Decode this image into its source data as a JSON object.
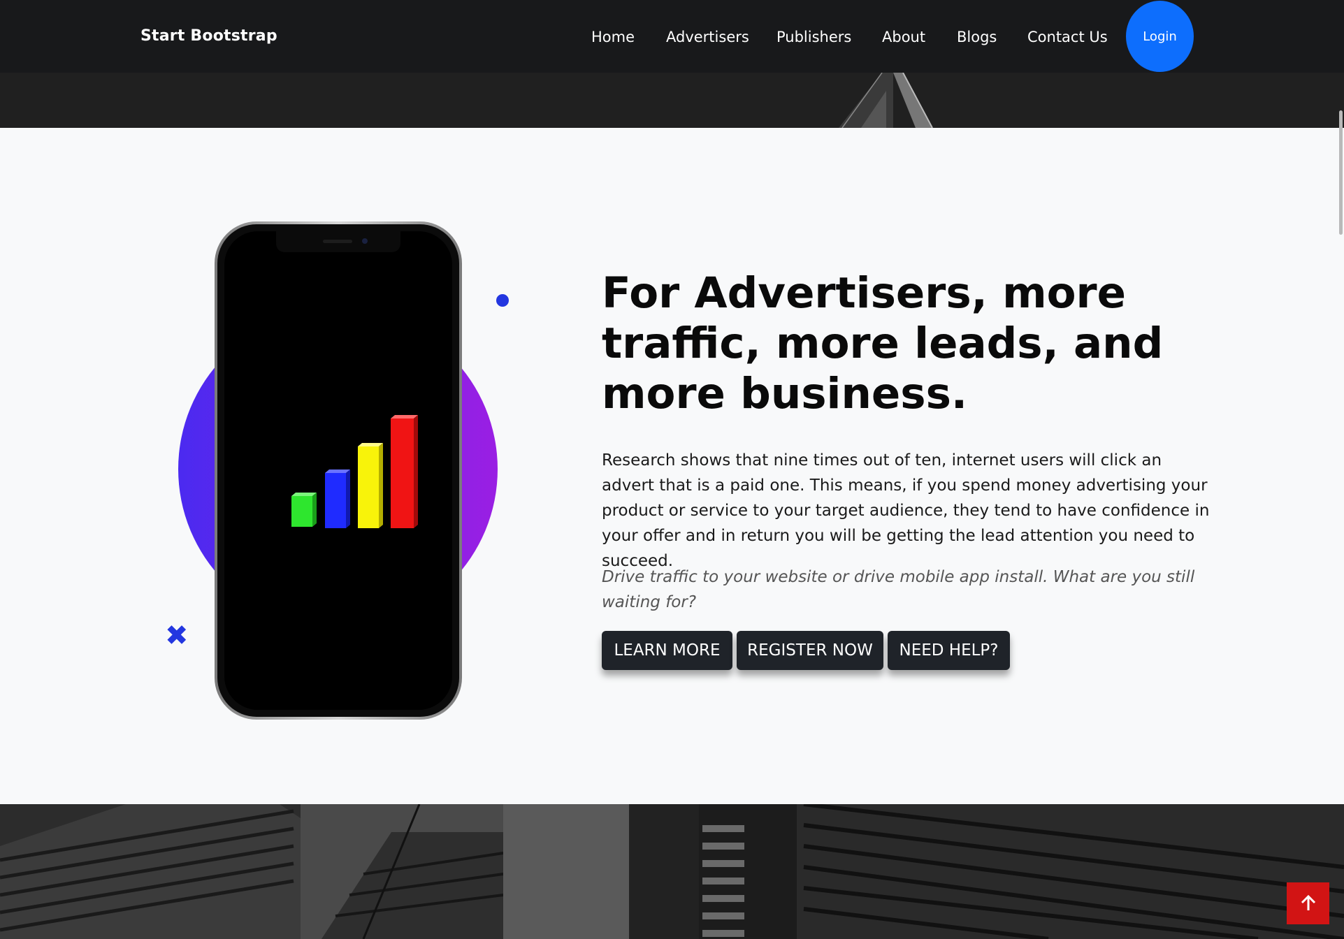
{
  "navbar": {
    "brand": "Start Bootstrap",
    "links": [
      "Home",
      "Advertisers",
      "Publishers",
      "About",
      "Blogs",
      "Contact Us"
    ],
    "login_label": "Login"
  },
  "hero": {
    "headline": "For Advertisers, more traffic, more leads, and more business.",
    "paragraph": "Research shows that nine times out of ten, internet users will click an advert that is a paid one. This means, if you spend money advertising your product or service to your target audience, they tend to have confidence in your offer and in return you will be getting the lead attention you need to succeed.",
    "tagline": "Drive traffic to your website or drive mobile app install. What are you still waiting for?",
    "buttons": {
      "learn_more": "LEARN MORE",
      "register_now": "REGISTER NOW",
      "need_help": "NEED HELP?"
    }
  },
  "icons": {
    "scroll_top": "arrow-up-icon",
    "decor_cross": "cross-icon",
    "decor_dot": "dot-icon"
  },
  "colors": {
    "navbar_bg": "#18191b",
    "login_accent": "#0d6efd",
    "button_bg": "#1f2329",
    "scroll_top_bg": "#d21414",
    "circle_start": "#4b2af0",
    "circle_end": "#9a1fe3",
    "bar_colors": [
      "#2ee62e",
      "#1f2bff",
      "#f8f30a",
      "#f01414"
    ]
  }
}
